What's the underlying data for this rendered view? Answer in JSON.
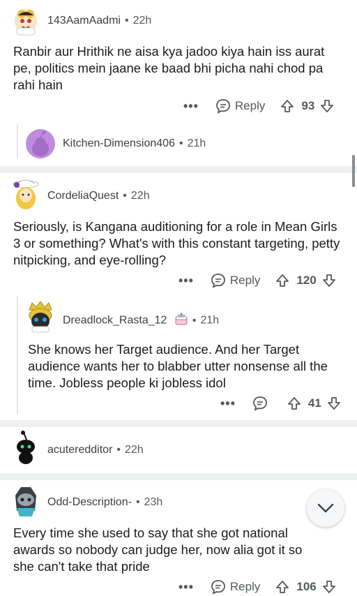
{
  "comments": [
    {
      "username": "143AamAadmi",
      "dot": "•",
      "age": "22h",
      "text": "Ranbir  aur Hrithik ne aisa kya jadoo kiya hain iss aurat pe, politics mein jaane ke baad bhi picha nahi chod pa rahi hain",
      "more": "•••",
      "reply_label": "Reply",
      "votes": "93"
    },
    {
      "username": "Kitchen-Dimension406",
      "dot": "•",
      "age": "21h"
    },
    {
      "username": "CordeliaQuest",
      "dot": "•",
      "age": "22h",
      "text": "Seriously, is Kangana auditioning for a role in Mean Girls 3 or something? What's with this constant targeting, petty nitpicking, and eye-rolling?",
      "more": "•••",
      "reply_label": "Reply",
      "votes": "120"
    },
    {
      "username": "Dreadlock_Rasta_12",
      "dot": "•",
      "age": "21h",
      "text": "She knows her Target audience. And her Target audience wants her to blabber utter nonsense all the time. Jobless people ki jobless idol",
      "more": "•••",
      "votes": "41"
    },
    {
      "username": "acuteredditor",
      "dot": "•",
      "age": "22h"
    },
    {
      "username": "Odd-Description-",
      "dot": "•",
      "age": "23h",
      "text": "Every time she used to say that she got national awards so nobody can judge her, now alia got it so she can't take that pride",
      "more": "•••",
      "reply_label": "Reply",
      "votes": "106"
    }
  ],
  "colors": {
    "background": "#ffffff",
    "separator": "#eef0f1",
    "text": "#1c1c1c",
    "meta": "#55595c",
    "snoo_purple": "#c08ce0"
  }
}
